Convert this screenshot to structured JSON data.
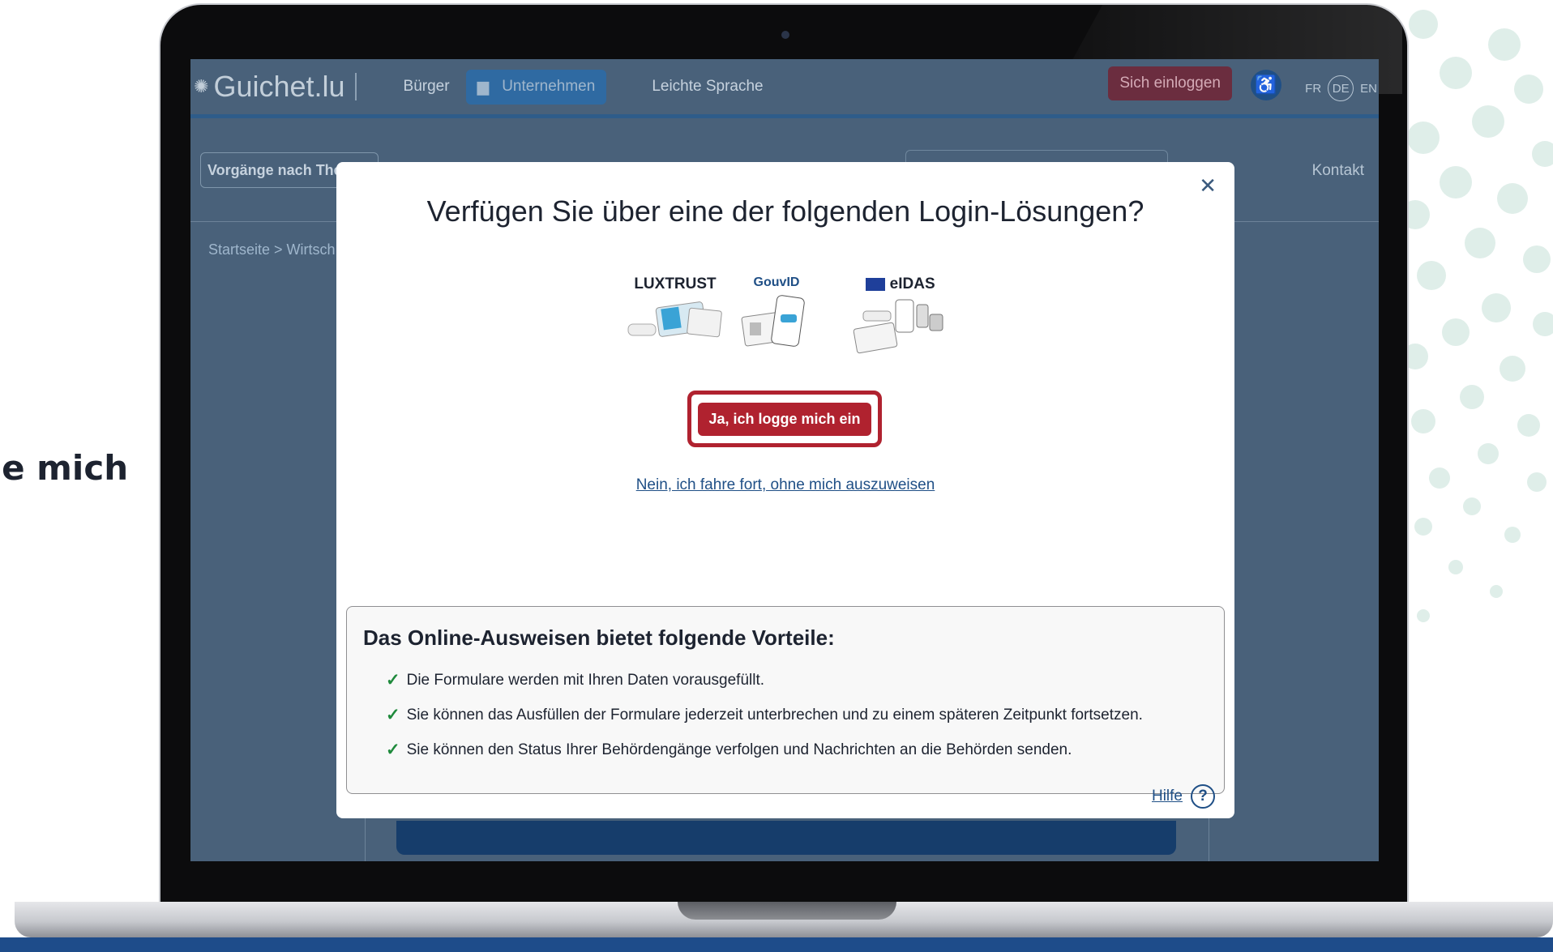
{
  "side_caption": "ge mich",
  "site": {
    "logo": "Guichet.lu",
    "nav": {
      "buerger": "Bürger",
      "unternehmen": "Unternehmen",
      "leichte_sprache": "Leichte Sprache"
    },
    "login_button": "Sich einloggen",
    "languages": [
      "FR",
      "DE",
      "EN"
    ],
    "themes_field": "Vorgänge nach The",
    "kontakt": "Kontakt",
    "breadcrumb": "Startseite > Wirtsch"
  },
  "modal": {
    "title": "Verfügen Sie über eine der folgenden Login-Lösungen?",
    "logos": [
      "LUXTRUST",
      "GouvID",
      "eIDAS"
    ],
    "cta_label": "Ja, ich logge mich ein",
    "skip_label": "Nein, ich fahre fort, ohne mich auszuweisen",
    "benefits": {
      "title": "Das Online-Ausweisen bietet folgende Vorteile:",
      "items": [
        "Die Formulare werden mit Ihren Daten vorausgefüllt.",
        "Sie können das Ausfüllen der Formulare jederzeit unterbrechen und zu einem späteren Zeitpunkt fortsetzen.",
        "Sie können den Status Ihrer Behördengänge verfolgen und Nachrichten an die Behörden senden."
      ]
    },
    "help_label": "Hilfe"
  },
  "colors": {
    "cta": "#b0222f",
    "link": "#1f4f86",
    "overlay": "#49617a",
    "check": "#1f8a3c"
  }
}
